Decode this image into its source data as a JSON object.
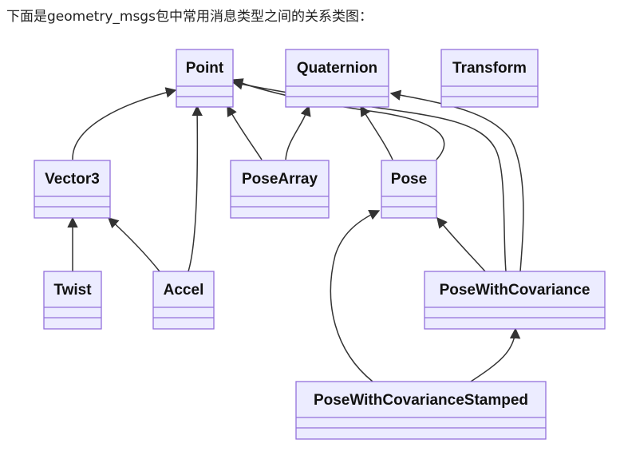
{
  "intro": "下面是geometry_msgs包中常用消息类型之间的关系类图：",
  "classes": {
    "point": "Point",
    "quaternion": "Quaternion",
    "transform": "Transform",
    "vector3": "Vector3",
    "posearray": "PoseArray",
    "pose": "Pose",
    "twist": "Twist",
    "accel": "Accel",
    "posewithcov": "PoseWithCovariance",
    "posewithcovstamped": "PoseWithCovarianceStamped"
  },
  "colors": {
    "box_fill": "#ECECFF",
    "box_stroke": "#9370DB",
    "edge": "#333333"
  }
}
